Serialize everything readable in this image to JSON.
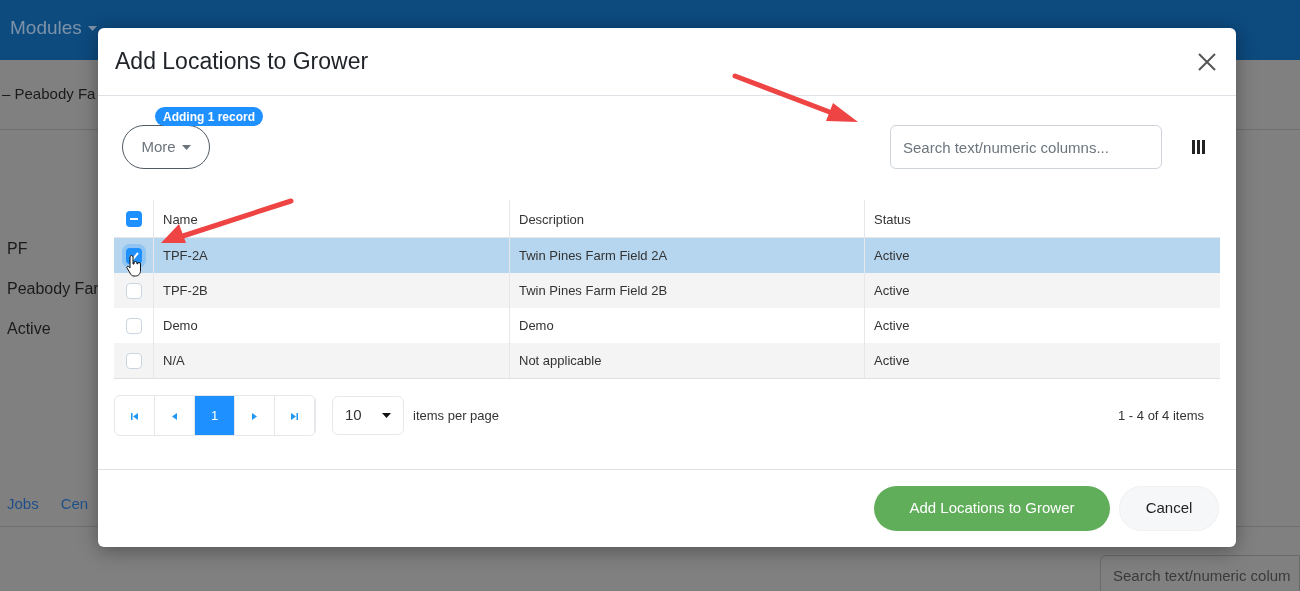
{
  "navbar": {
    "items": [
      {
        "label": "Modules",
        "dropdown": true
      }
    ]
  },
  "background": {
    "heading": "– Peabody Fa",
    "fields": [
      "PF",
      "Peabody Far",
      "Active"
    ],
    "tabs": [
      "Jobs",
      "Cen"
    ],
    "search": {
      "placeholder": "Search text/numeric colum"
    }
  },
  "dialog": {
    "title": "Add Locations to Grower",
    "more_button": "More",
    "badge": "Adding 1 record",
    "search": {
      "placeholder": "Search text/numeric columns..."
    },
    "select_all": {
      "indeterminate": true
    },
    "columns": [
      "Name",
      "Description",
      "Status"
    ],
    "rows": [
      {
        "cells": [
          "TPF-2A",
          "Twin Pines Farm Field 2A",
          "Active"
        ],
        "selected": true
      },
      {
        "cells": [
          "TPF-2B",
          "Twin Pines Farm Field 2B",
          "Active"
        ],
        "selected": false
      },
      {
        "cells": [
          "Demo",
          "Demo",
          "Active"
        ],
        "selected": false
      },
      {
        "cells": [
          "N/A",
          "Not applicable",
          "Active"
        ],
        "selected": false
      }
    ],
    "pager": {
      "pages": [
        {
          "label": "1",
          "selected": true
        }
      ],
      "page_size": "10",
      "page_size_label": "items per page",
      "summary": "1 - 4 of 4 items"
    },
    "buttons": [
      {
        "label": "Add Locations to Grower",
        "kind": "primary"
      },
      {
        "label": "Cancel",
        "kind": "secondary"
      }
    ]
  }
}
